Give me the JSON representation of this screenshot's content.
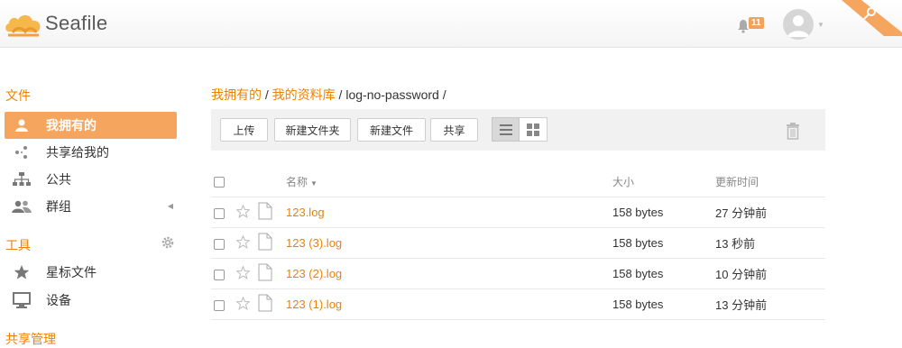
{
  "header": {
    "brand": "Seafile",
    "notification_count": "11",
    "accent_color": "#eb8205"
  },
  "sidebar": {
    "files_section": "文件",
    "items": [
      {
        "label": "我拥有的",
        "icon": "user-icon",
        "active": true
      },
      {
        "label": "共享给我的",
        "icon": "share-icon",
        "active": false
      },
      {
        "label": "公共",
        "icon": "sitemap-icon",
        "active": false
      },
      {
        "label": "群组",
        "icon": "group-icon",
        "active": false
      }
    ],
    "tools_section": "工具",
    "tools": [
      {
        "label": "星标文件",
        "icon": "star-icon"
      },
      {
        "label": "设备",
        "icon": "monitor-icon"
      }
    ],
    "share_admin_section": "共享管理"
  },
  "breadcrumb": {
    "part1": "我拥有的",
    "sep": " / ",
    "part2": "我的资料库",
    "current": "log-no-password",
    "trail": " /"
  },
  "toolbar": {
    "upload": "上传",
    "new_folder": "新建文件夹",
    "new_file": "新建文件",
    "share": "共享"
  },
  "table": {
    "headers": {
      "name": "名称",
      "size": "大小",
      "updated": "更新时间"
    },
    "rows": [
      {
        "name": "123.log",
        "size": "158 bytes",
        "updated": "27 分钟前"
      },
      {
        "name": "123 (3).log",
        "size": "158 bytes",
        "updated": "13 秒前"
      },
      {
        "name": "123 (2).log",
        "size": "158 bytes",
        "updated": "10 分钟前"
      },
      {
        "name": "123 (1).log",
        "size": "158 bytes",
        "updated": "13 分钟前"
      }
    ]
  }
}
